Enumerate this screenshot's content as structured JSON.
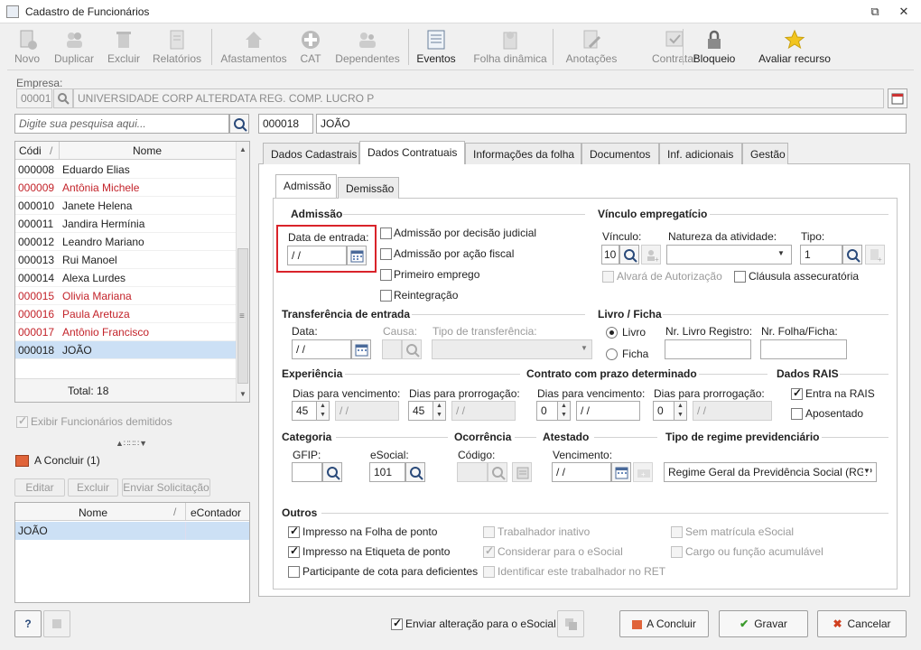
{
  "window": {
    "title": "Cadastro de Funcionários",
    "restore": "⧉",
    "close": "✕"
  },
  "toolbar": [
    {
      "label": "Novo",
      "icon": "new-doc-icon",
      "enabled": false
    },
    {
      "label": "Duplicar",
      "icon": "users-icon",
      "enabled": false
    },
    {
      "label": "Excluir",
      "icon": "trash-icon",
      "enabled": false
    },
    {
      "label": "Relatórios",
      "icon": "report-icon",
      "enabled": false
    },
    {
      "label": "Afastamentos",
      "icon": "house-icon",
      "enabled": false
    },
    {
      "label": "CAT",
      "icon": "plus-circle-icon",
      "enabled": false
    },
    {
      "label": "Dependentes",
      "icon": "dependents-icon",
      "enabled": false
    },
    {
      "label": "Eventos",
      "icon": "events-icon",
      "enabled": true
    },
    {
      "label": "Folha dinâmica",
      "icon": "dynamic-sheet-icon",
      "enabled": false
    },
    {
      "label": "Anotações",
      "icon": "notes-icon",
      "enabled": false
    },
    {
      "label": "Contratar",
      "icon": "hire-icon",
      "enabled": false
    },
    {
      "label": "Bloqueio",
      "icon": "lock-icon",
      "enabled": true
    },
    {
      "label": "Avaliar recurso",
      "icon": "star-icon",
      "enabled": true
    }
  ],
  "empresa": {
    "label": "Empresa:",
    "code": "00001",
    "name": "UNIVERSIDADE CORP ALTERDATA REG. COMP. LUCRO P"
  },
  "search": {
    "placeholder": "Digite sua pesquisa aqui...",
    "code": "000018",
    "name": "JOÃO"
  },
  "employees": {
    "col_code": "Códi",
    "col_name": "Nome",
    "sort_mark": "/",
    "rows": [
      {
        "code": "000008",
        "name": "Eduardo Elias",
        "dismissed": false
      },
      {
        "code": "000009",
        "name": "Antônia Michele",
        "dismissed": true
      },
      {
        "code": "000010",
        "name": "Janete Helena",
        "dismissed": false
      },
      {
        "code": "000011",
        "name": "Jandira Hermínia",
        "dismissed": false
      },
      {
        "code": "000012",
        "name": "Leandro Mariano",
        "dismissed": false
      },
      {
        "code": "000013",
        "name": "Rui Manoel",
        "dismissed": false
      },
      {
        "code": "000014",
        "name": "Alexa Lurdes",
        "dismissed": false
      },
      {
        "code": "000015",
        "name": "Olivia Mariana",
        "dismissed": true
      },
      {
        "code": "000016",
        "name": "Paula Aretuza",
        "dismissed": true
      },
      {
        "code": "000017",
        "name": "Antônio Francisco",
        "dismissed": true
      },
      {
        "code": "000018",
        "name": "JOÃO",
        "dismissed": false,
        "selected": true
      }
    ],
    "total": "Total: 18"
  },
  "show_dismissed": "Exibir Funcionários demitidos",
  "pending": {
    "title": "A Concluir (1)",
    "edit": "Editar",
    "delete": "Excluir",
    "send": "Enviar Solicitação",
    "col_name": "Nome",
    "col_econtador": "eContador",
    "rows": [
      {
        "name": "JOÃO",
        "econtador": ""
      }
    ]
  },
  "tabs": [
    "Dados Cadastrais",
    "Dados Contratuais",
    "Informações da folha",
    "Documentos",
    "Inf. adicionais",
    "Gestão"
  ],
  "subtabs": [
    "Admissão",
    "Demissão"
  ],
  "admissao": {
    "group": "Admissão",
    "date_label": "Data de entrada:",
    "date_value": "/ /",
    "checks": [
      "Admissão por decisão judicial",
      "Admissão por ação fiscal",
      "Primeiro emprego",
      "Reintegração"
    ]
  },
  "vinculo": {
    "group": "Vínculo empregatício",
    "vinculo_label": "Vínculo:",
    "vinculo_value": "10",
    "natureza_label": "Natureza da atividade:",
    "natureza_value": "",
    "tipo_label": "Tipo:",
    "tipo_value": "1",
    "alvara": "Alvará de Autorização",
    "clausula": "Cláusula assecuratória"
  },
  "transferencia": {
    "group": "Transferência de entrada",
    "data_label": "Data:",
    "data_value": "/ /",
    "causa_label": "Causa:",
    "tipo_label": "Tipo de transferência:"
  },
  "livro": {
    "group": "Livro / Ficha",
    "livro": "Livro",
    "ficha": "Ficha",
    "nr_livro": "Nr. Livro Registro:",
    "nr_folha": "Nr. Folha/Ficha:"
  },
  "experiencia": {
    "group": "Experiência",
    "venc_label": "Dias para vencimento:",
    "venc_value": "45",
    "venc_date": "/ /",
    "prorr_label": "Dias para prorrogação:",
    "prorr_value": "45",
    "prorr_date": "/ /"
  },
  "contrato": {
    "group": "Contrato com prazo determinado",
    "venc_label": "Dias para vencimento:",
    "venc_value": "0",
    "venc_date": "/ /",
    "prorr_label": "Dias para prorrogação:",
    "prorr_value": "0",
    "prorr_date": "/ /"
  },
  "rais": {
    "group": "Dados RAIS",
    "entra": "Entra na RAIS",
    "aposentado": "Aposentado"
  },
  "categoria": {
    "group": "Categoria",
    "gfip": "GFIP:",
    "esocial": "eSocial:",
    "esocial_value": "101"
  },
  "ocorrencia": {
    "group": "Ocorrência",
    "codigo": "Código:"
  },
  "atestado": {
    "group": "Atestado",
    "vencimento": "Vencimento:",
    "value": "/ /"
  },
  "regime": {
    "group": "Tipo de regime previdenciário",
    "value": "Regime Geral da Previdência Social (RGP"
  },
  "outros": {
    "group": "Outros",
    "items": [
      {
        "label": "Impresso na Folha de ponto",
        "checked": true,
        "enabled": true
      },
      {
        "label": "Impresso na Etiqueta de ponto",
        "checked": true,
        "enabled": true
      },
      {
        "label": "Participante de cota para deficientes",
        "checked": false,
        "enabled": true
      },
      {
        "label": "Trabalhador inativo",
        "checked": false,
        "enabled": false
      },
      {
        "label": "Considerar para o eSocial",
        "checked": true,
        "enabled": false
      },
      {
        "label": "Identificar este trabalhador no RET",
        "checked": false,
        "enabled": false
      },
      {
        "label": "Sem matrícula eSocial",
        "checked": false,
        "enabled": false
      },
      {
        "label": "Cargo ou função acumulável",
        "checked": false,
        "enabled": false
      }
    ]
  },
  "footer": {
    "help": "?",
    "send_change": "Enviar alteração para o eSocial",
    "a_concluir": "A Concluir",
    "gravar": "Gravar",
    "cancelar": "Cancelar"
  },
  "colors": {
    "highlight": "#d9232a",
    "accent_save": "#3a9a2c",
    "accent_cancel": "#d04020",
    "selected_row": "#cce0f5"
  }
}
